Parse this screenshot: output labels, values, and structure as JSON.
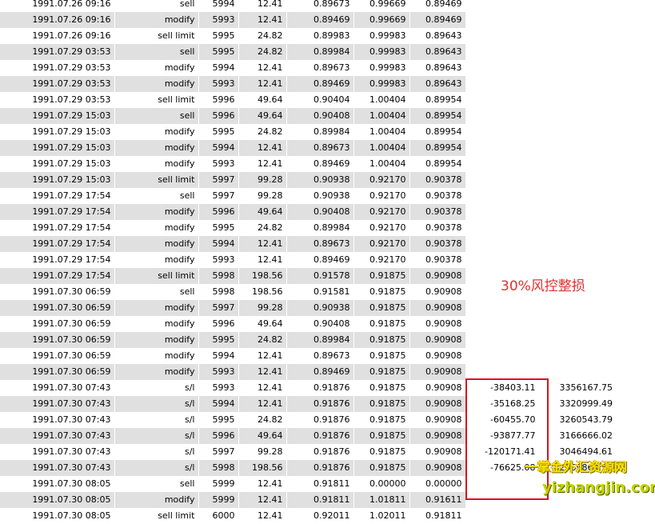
{
  "rows": [
    [
      "1991.07.26 09:16",
      "sell",
      "5994",
      "12.41",
      "0.89673",
      "0.99669",
      "0.89469",
      "",
      ""
    ],
    [
      "1991.07.26 09:16",
      "modify",
      "5993",
      "12.41",
      "0.89469",
      "0.99669",
      "0.89469",
      "",
      ""
    ],
    [
      "1991.07.26 09:16",
      "sell limit",
      "5995",
      "24.82",
      "0.89983",
      "0.99983",
      "0.89643",
      "",
      ""
    ],
    [
      "1991.07.29 03:53",
      "sell",
      "5995",
      "24.82",
      "0.89984",
      "0.99983",
      "0.89643",
      "",
      ""
    ],
    [
      "1991.07.29 03:53",
      "modify",
      "5994",
      "12.41",
      "0.89673",
      "0.99983",
      "0.89643",
      "",
      ""
    ],
    [
      "1991.07.29 03:53",
      "modify",
      "5993",
      "12.41",
      "0.89469",
      "0.99983",
      "0.89643",
      "",
      ""
    ],
    [
      "1991.07.29 03:53",
      "sell limit",
      "5996",
      "49.64",
      "0.90404",
      "1.00404",
      "0.89954",
      "",
      ""
    ],
    [
      "1991.07.29 15:03",
      "sell",
      "5996",
      "49.64",
      "0.90408",
      "1.00404",
      "0.89954",
      "",
      ""
    ],
    [
      "1991.07.29 15:03",
      "modify",
      "5995",
      "24.82",
      "0.89984",
      "1.00404",
      "0.89954",
      "",
      ""
    ],
    [
      "1991.07.29 15:03",
      "modify",
      "5994",
      "12.41",
      "0.89673",
      "1.00404",
      "0.89954",
      "",
      ""
    ],
    [
      "1991.07.29 15:03",
      "modify",
      "5993",
      "12.41",
      "0.89469",
      "1.00404",
      "0.89954",
      "",
      ""
    ],
    [
      "1991.07.29 15:03",
      "sell limit",
      "5997",
      "99.28",
      "0.90938",
      "0.92170",
      "0.90378",
      "",
      ""
    ],
    [
      "1991.07.29 17:54",
      "sell",
      "5997",
      "99.28",
      "0.90938",
      "0.92170",
      "0.90378",
      "",
      ""
    ],
    [
      "1991.07.29 17:54",
      "modify",
      "5996",
      "49.64",
      "0.90408",
      "0.92170",
      "0.90378",
      "",
      ""
    ],
    [
      "1991.07.29 17:54",
      "modify",
      "5995",
      "24.82",
      "0.89984",
      "0.92170",
      "0.90378",
      "",
      ""
    ],
    [
      "1991.07.29 17:54",
      "modify",
      "5994",
      "12.41",
      "0.89673",
      "0.92170",
      "0.90378",
      "",
      ""
    ],
    [
      "1991.07.29 17:54",
      "modify",
      "5993",
      "12.41",
      "0.89469",
      "0.92170",
      "0.90378",
      "",
      ""
    ],
    [
      "1991.07.29 17:54",
      "sell limit",
      "5998",
      "198.56",
      "0.91578",
      "0.91875",
      "0.90908",
      "",
      ""
    ],
    [
      "1991.07.30 06:59",
      "sell",
      "5998",
      "198.56",
      "0.91581",
      "0.91875",
      "0.90908",
      "",
      ""
    ],
    [
      "1991.07.30 06:59",
      "modify",
      "5997",
      "99.28",
      "0.90938",
      "0.91875",
      "0.90908",
      "",
      ""
    ],
    [
      "1991.07.30 06:59",
      "modify",
      "5996",
      "49.64",
      "0.90408",
      "0.91875",
      "0.90908",
      "",
      ""
    ],
    [
      "1991.07.30 06:59",
      "modify",
      "5995",
      "24.82",
      "0.89984",
      "0.91875",
      "0.90908",
      "",
      ""
    ],
    [
      "1991.07.30 06:59",
      "modify",
      "5994",
      "12.41",
      "0.89673",
      "0.91875",
      "0.90908",
      "",
      ""
    ],
    [
      "1991.07.30 06:59",
      "modify",
      "5993",
      "12.41",
      "0.89469",
      "0.91875",
      "0.90908",
      "",
      ""
    ],
    [
      "1991.07.30 07:43",
      "s/l",
      "5993",
      "12.41",
      "0.91876",
      "0.91875",
      "0.90908",
      "-38403.11",
      "3356167.75"
    ],
    [
      "1991.07.30 07:43",
      "s/l",
      "5994",
      "12.41",
      "0.91876",
      "0.91875",
      "0.90908",
      "-35168.25",
      "3320999.49"
    ],
    [
      "1991.07.30 07:43",
      "s/l",
      "5995",
      "24.82",
      "0.91876",
      "0.91875",
      "0.90908",
      "-60455.70",
      "3260543.79"
    ],
    [
      "1991.07.30 07:43",
      "s/l",
      "5996",
      "49.64",
      "0.91876",
      "0.91875",
      "0.90908",
      "-93877.77",
      "3166666.02"
    ],
    [
      "1991.07.30 07:43",
      "s/l",
      "5997",
      "99.28",
      "0.91876",
      "0.91875",
      "0.90908",
      "-120171.41",
      "3046494.61"
    ],
    [
      "1991.07.30 07:43",
      "s/l",
      "5998",
      "198.56",
      "0.91876",
      "0.91875",
      "0.90908",
      "-76625.08",
      "2969869.53"
    ],
    [
      "1991.07.30 08:05",
      "sell",
      "5999",
      "12.41",
      "0.91811",
      "0.00000",
      "0.00000",
      "",
      ""
    ],
    [
      "1991.07.30 08:05",
      "modify",
      "5999",
      "12.41",
      "0.91811",
      "1.01811",
      "0.91611",
      "",
      ""
    ],
    [
      "1991.07.30 08:05",
      "sell limit",
      "6000",
      "12.41",
      "0.92011",
      "1.02011",
      "0.91811",
      "",
      ""
    ]
  ],
  "annotation": {
    "text": "30%风控整损",
    "box_color": "#d8141b"
  },
  "watermark": {
    "chinese": "一掌金外汇资源网",
    "url": "yizhangjin.com"
  },
  "colors": {
    "row_stripe": "#e0e0e0",
    "annotation_red": "#e03030"
  }
}
